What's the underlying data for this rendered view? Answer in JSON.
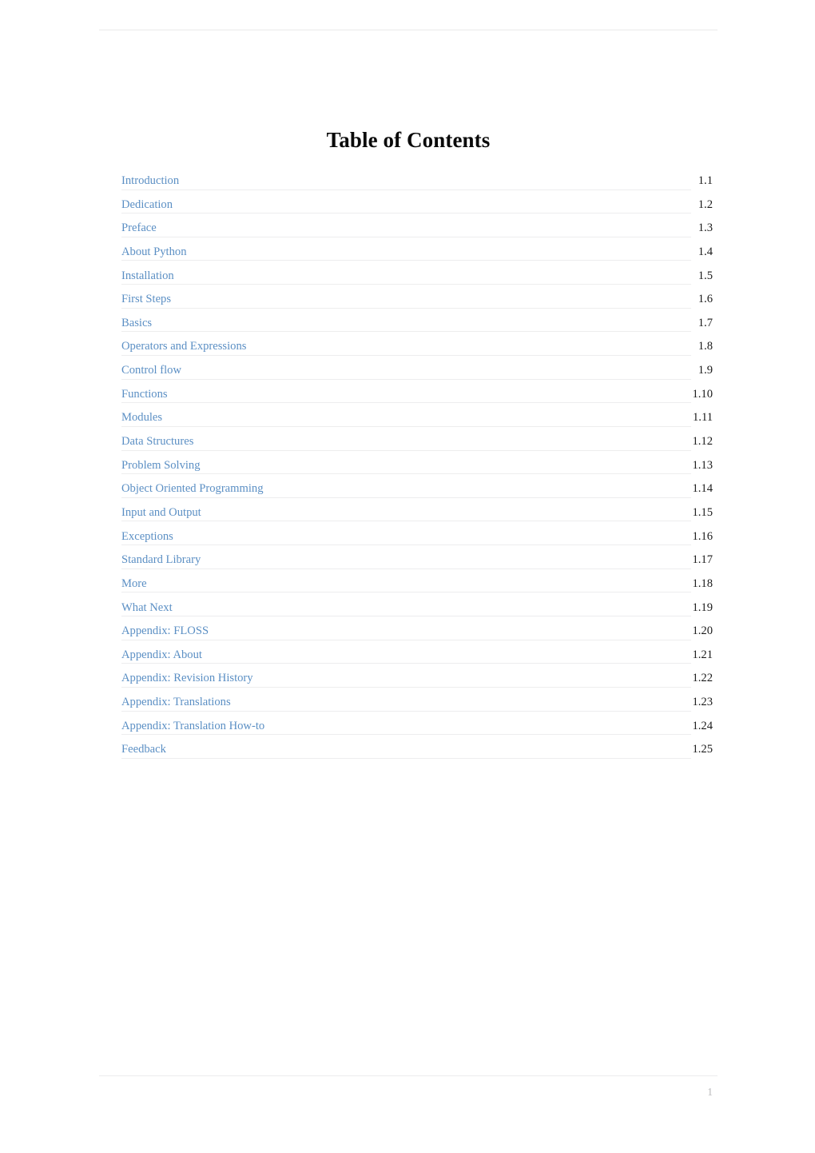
{
  "document": {
    "title": "Table of Contents",
    "folio": "1"
  },
  "toc": {
    "entries": [
      {
        "label": "Introduction",
        "number": "1.1"
      },
      {
        "label": "Dedication",
        "number": "1.2"
      },
      {
        "label": "Preface",
        "number": "1.3"
      },
      {
        "label": "About Python",
        "number": "1.4"
      },
      {
        "label": "Installation",
        "number": "1.5"
      },
      {
        "label": "First Steps",
        "number": "1.6"
      },
      {
        "label": "Basics",
        "number": "1.7"
      },
      {
        "label": "Operators and Expressions",
        "number": "1.8"
      },
      {
        "label": "Control flow",
        "number": "1.9"
      },
      {
        "label": "Functions",
        "number": "1.10"
      },
      {
        "label": "Modules",
        "number": "1.11"
      },
      {
        "label": "Data Structures",
        "number": "1.12"
      },
      {
        "label": "Problem Solving",
        "number": "1.13"
      },
      {
        "label": "Object Oriented Programming",
        "number": "1.14"
      },
      {
        "label": "Input and Output",
        "number": "1.15"
      },
      {
        "label": "Exceptions",
        "number": "1.16"
      },
      {
        "label": "Standard Library",
        "number": "1.17"
      },
      {
        "label": "More",
        "number": "1.18"
      },
      {
        "label": "What Next",
        "number": "1.19"
      },
      {
        "label": "Appendix: FLOSS",
        "number": "1.20"
      },
      {
        "label": "Appendix: About",
        "number": "1.21"
      },
      {
        "label": "Appendix: Revision History",
        "number": "1.22"
      },
      {
        "label": "Appendix: Translations",
        "number": "1.23"
      },
      {
        "label": "Appendix: Translation How-to",
        "number": "1.24"
      },
      {
        "label": "Feedback",
        "number": "1.25"
      }
    ]
  },
  "colors": {
    "link": "#5b8fc4",
    "number": "#1b1b1b",
    "rule": "#ededee",
    "folio": "#b9b9bb",
    "page_background": "#ffffff"
  }
}
